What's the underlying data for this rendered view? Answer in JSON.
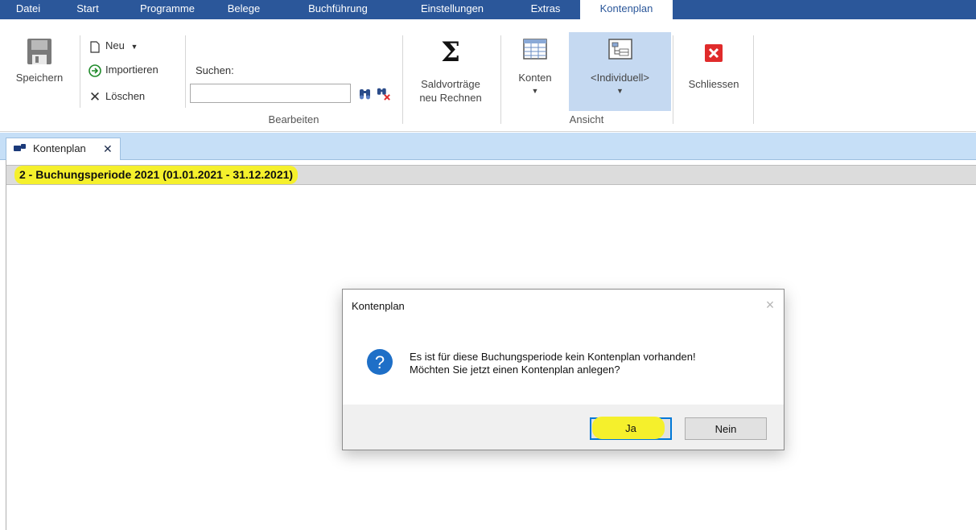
{
  "menu": {
    "items": [
      "Datei",
      "Start",
      "Programme",
      "Belege",
      "Buchführung",
      "Einstellungen",
      "Extras",
      "Kontenplan"
    ],
    "active": "Kontenplan"
  },
  "ribbon": {
    "save": "Speichern",
    "new": "Neu",
    "import": "Importieren",
    "delete": "Löschen",
    "search_label": "Suchen:",
    "search_value": "",
    "group_edit": "Bearbeiten",
    "saldo_line1": "Saldvorträge",
    "saldo_line2": "neu Rechnen",
    "konten": "Konten",
    "individuell": "<Individuell>",
    "group_view": "Ansicht",
    "close": "Schliessen"
  },
  "tabs": [
    {
      "label": "Kontenplan",
      "close": "✕"
    }
  ],
  "period": {
    "text": "2 - Buchungsperiode 2021 (01.01.2021 - 31.12.2021)"
  },
  "dialog": {
    "title": "Kontenplan",
    "close": "×",
    "message_line1": "Es ist für diese Buchungsperiode kein Kontenplan vorhanden!",
    "message_line2": "Möchten Sie jetzt einen Kontenplan anlegen?",
    "yes": "Ja",
    "no": "Nein"
  },
  "colors": {
    "menubar": "#2b579a",
    "tabstrip": "#c6dff7",
    "highlight": "#f5f02c",
    "selected_view": "#c5d9f1",
    "question_icon": "#1e6fc7",
    "close_red": "#e02b2b"
  }
}
